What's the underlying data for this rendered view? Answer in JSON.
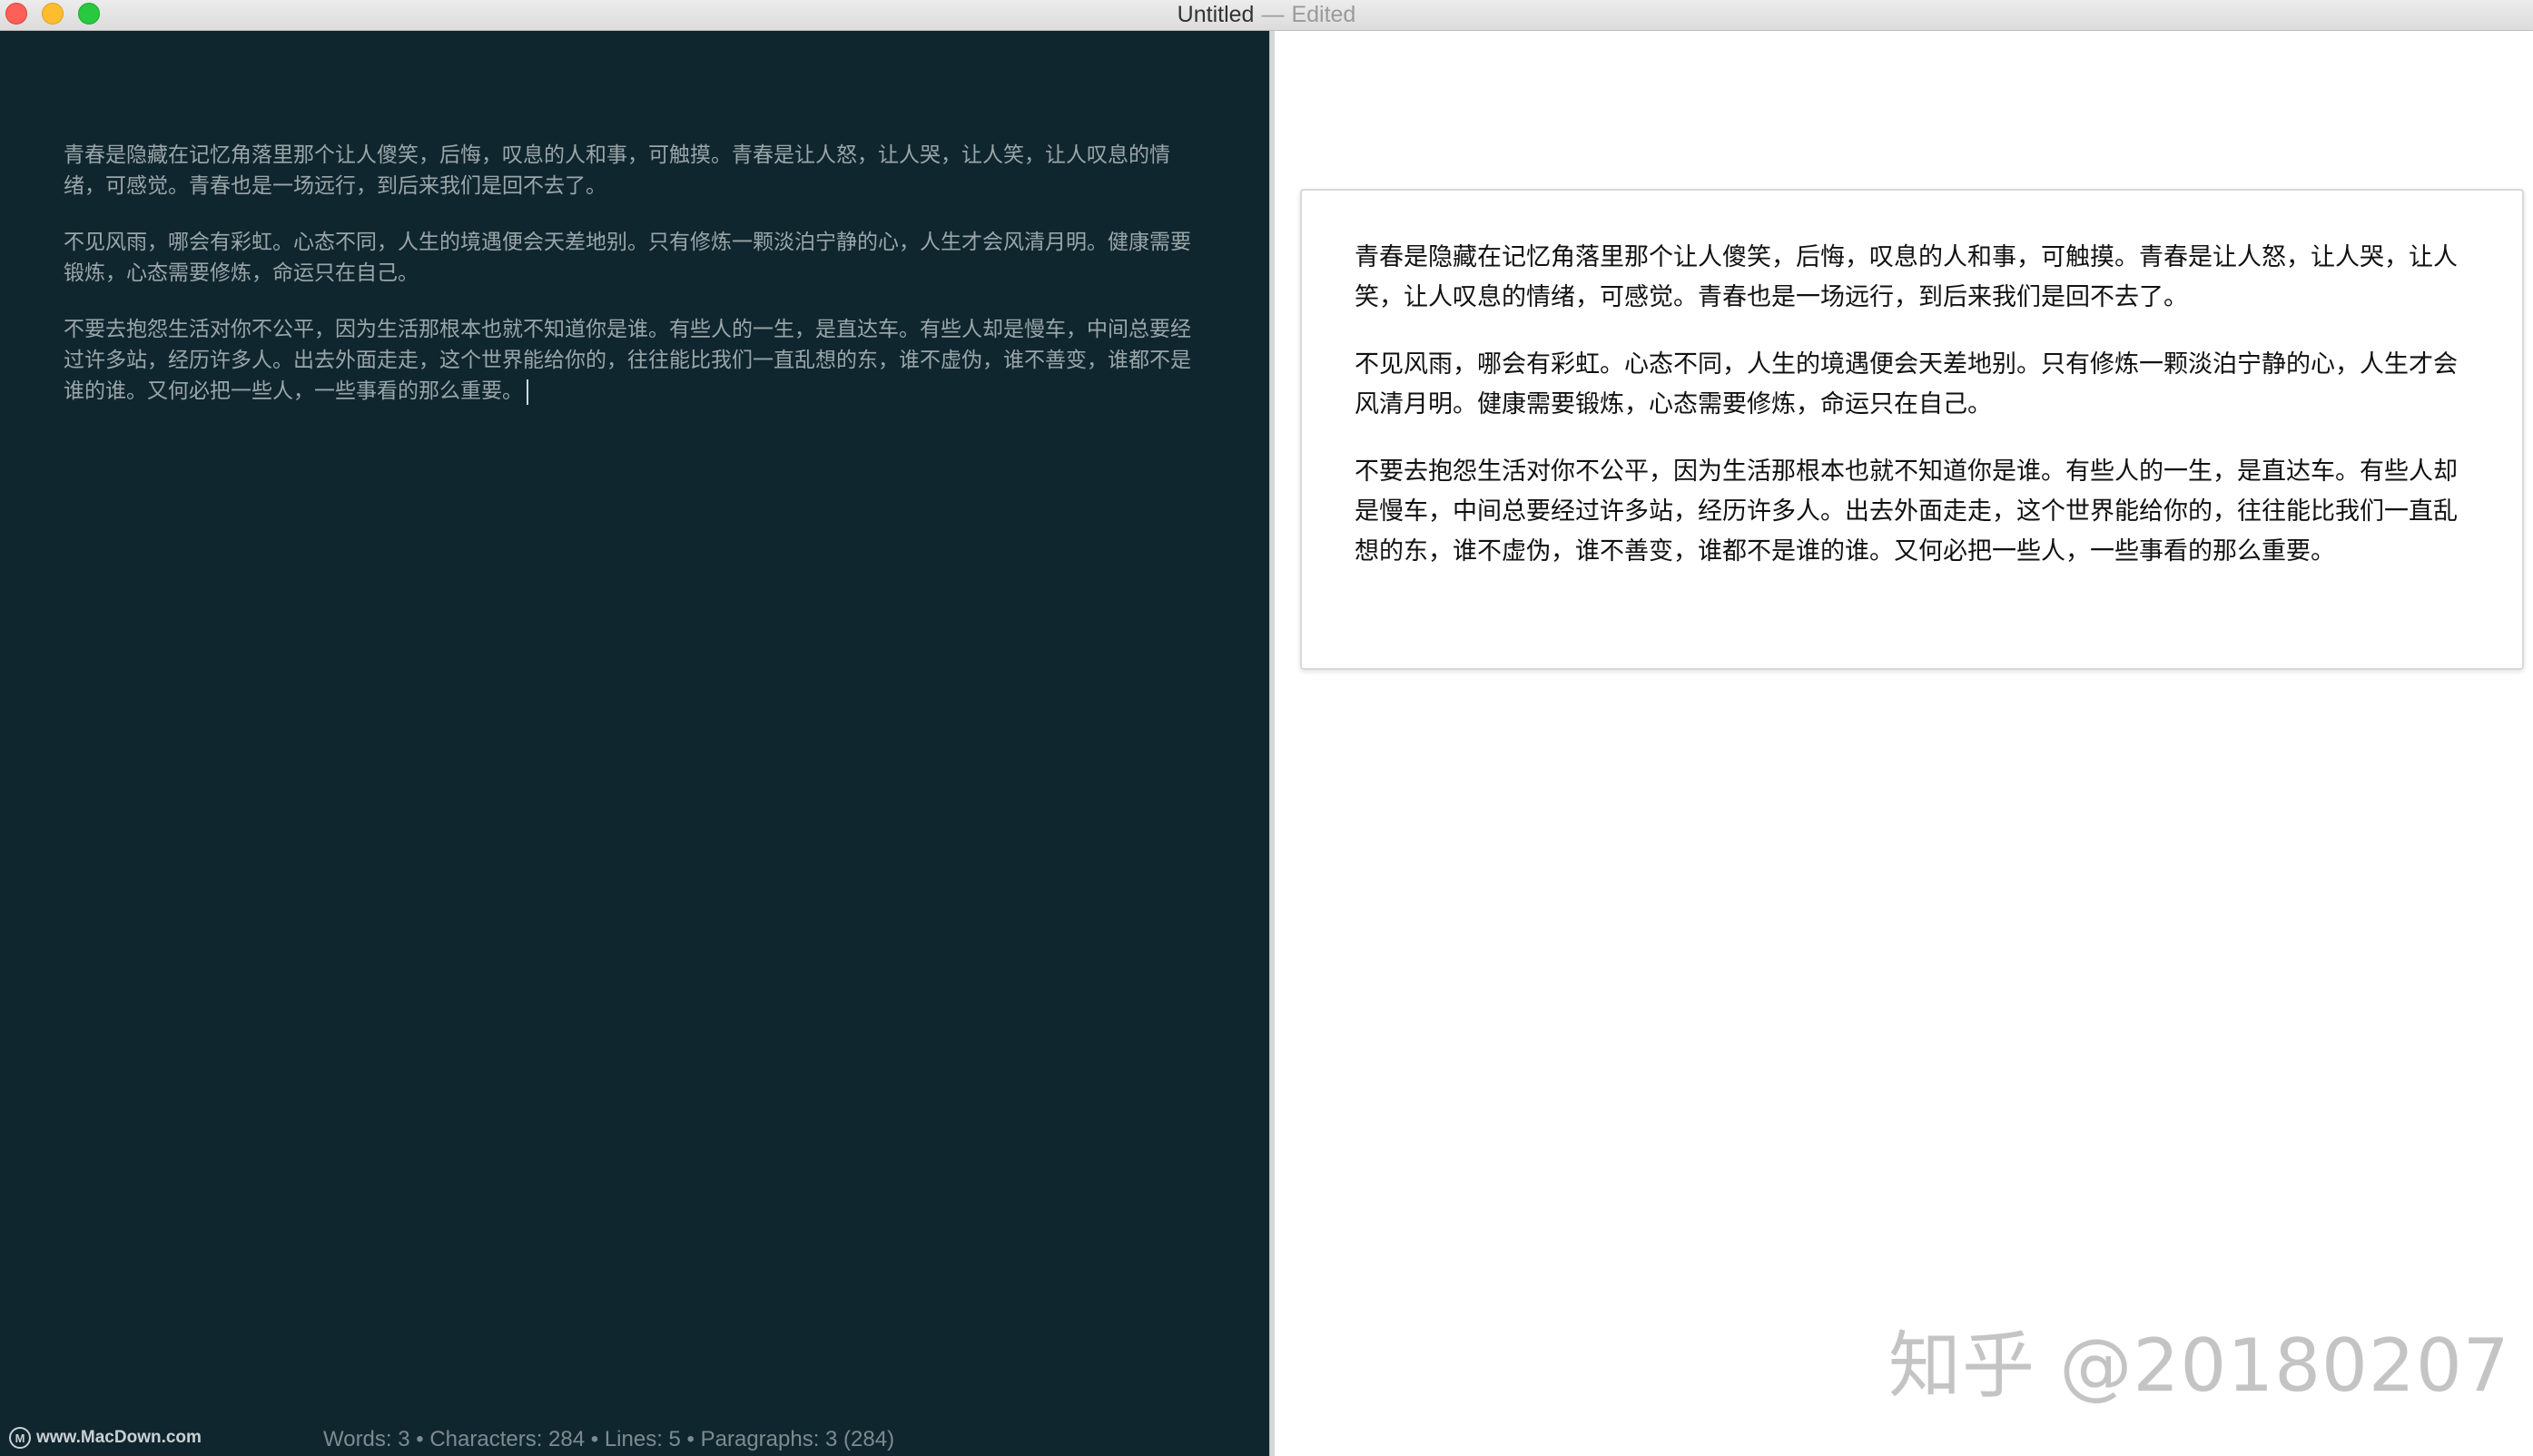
{
  "window": {
    "title": "Untitled",
    "separator": "—",
    "status": "Edited"
  },
  "editor": {
    "paragraphs": [
      "青春是隐藏在记忆角落里那个让人傻笑，后悔，叹息的人和事，可触摸。青春是让人怒，让人哭，让人笑，让人叹息的情绪，可感觉。青春也是一场远行，到后来我们是回不去了。",
      "不见风雨，哪会有彩虹。心态不同，人生的境遇便会天差地别。只有修炼一颗淡泊宁静的心，人生才会风清月明。健康需要锻炼，心态需要修炼，命运只在自己。",
      "不要去抱怨生活对你不公平，因为生活那根本也就不知道你是谁。有些人的一生，是直达车。有些人却是慢车，中间总要经过许多站，经历许多人。出去外面走走，这个世界能给你的，往往能比我们一直乱想的东，谁不虚伪，谁不善变，谁都不是谁的谁。又何必把一些人，一些事看的那么重要。"
    ]
  },
  "status_bar": {
    "logo_text": "www.MacDown.com",
    "stats": "Words: 3 • Characters: 284 • Lines: 5 • Paragraphs: 3 (284)"
  },
  "preview": {
    "paragraphs": [
      "青春是隐藏在记忆角落里那个让人傻笑，后悔，叹息的人和事，可触摸。青春是让人怒，让人哭，让人笑，让人叹息的情绪，可感觉。青春也是一场远行，到后来我们是回不去了。",
      "不见风雨，哪会有彩虹。心态不同，人生的境遇便会天差地别。只有修炼一颗淡泊宁静的心，人生才会风清月明。健康需要锻炼，心态需要修炼，命运只在自己。",
      "不要去抱怨生活对你不公平，因为生活那根本也就不知道你是谁。有些人的一生，是直达车。有些人却是慢车，中间总要经过许多站，经历许多人。出去外面走走，这个世界能给你的，往往能比我们一直乱想的东，谁不虚伪，谁不善变，谁都不是谁的谁。又何必把一些人，一些事看的那么重要。"
    ]
  },
  "watermark": "知乎 @20180207",
  "colors": {
    "editor_bg": "#10262f",
    "editor_text": "#9aa6a9",
    "preview_bg": "#ffffff"
  }
}
